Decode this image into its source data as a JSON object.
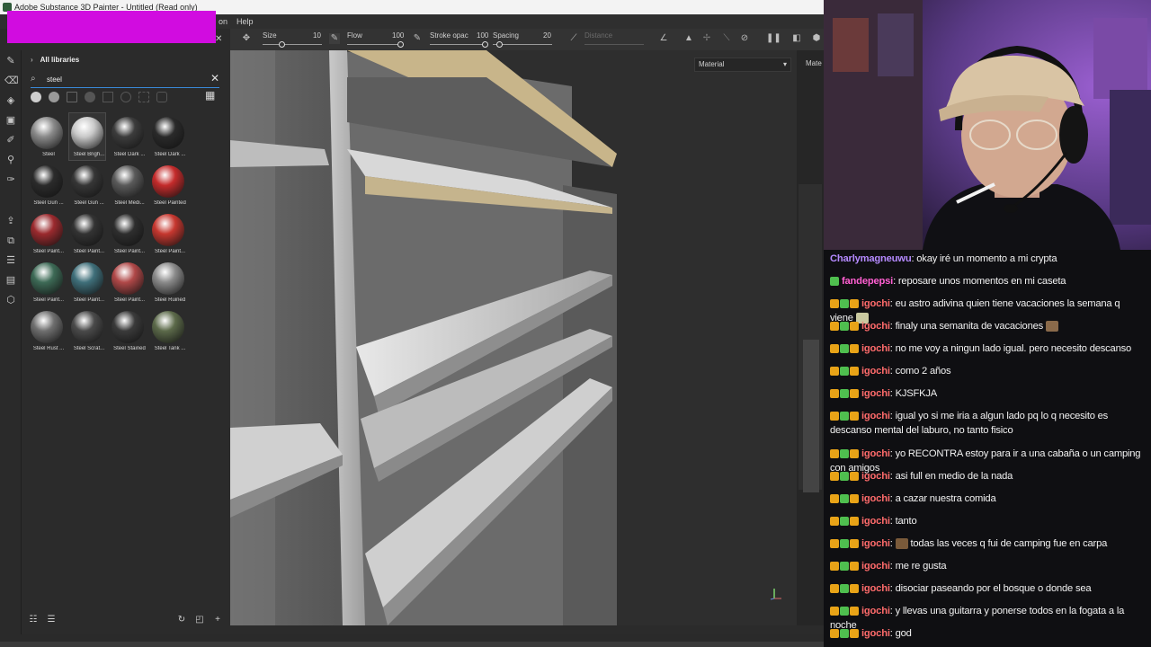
{
  "window": {
    "title": "Adobe Substance 3D Painter - Untitled (Read only)",
    "menu": [
      "on",
      "Help"
    ]
  },
  "toolbar": {
    "size_label": "Size",
    "size_value": "10",
    "flow_label": "Flow",
    "flow_value": "100",
    "stroke_label": "Stroke opac",
    "stroke_value": "100",
    "spacing_label": "Spacing",
    "spacing_value": "20",
    "distance_label": "Distance"
  },
  "assets": {
    "header": "All libraries",
    "search_value": "steel",
    "items": [
      {
        "label": "Steel",
        "color": "#8a8a8a"
      },
      {
        "label": "Steel Brigh...",
        "color": "#c9c9c9"
      },
      {
        "label": "Steel Dark ...",
        "color": "#3c3c3c"
      },
      {
        "label": "Steel Dark ...",
        "color": "#2a2a2a"
      },
      {
        "label": "Steel Gun ...",
        "color": "#2b2b2b"
      },
      {
        "label": "Steel Gun ...",
        "color": "#363636"
      },
      {
        "label": "Steel Medi...",
        "color": "#5a5a5a"
      },
      {
        "label": "Steel Painted",
        "color": "#c42b2b"
      },
      {
        "label": "Steel Paint...",
        "color": "#9b2a2e"
      },
      {
        "label": "Steel Paint...",
        "color": "#333333"
      },
      {
        "label": "Steel Paint...",
        "color": "#2e2e2e"
      },
      {
        "label": "Steel Paint...",
        "color": "#c6372f"
      },
      {
        "label": "Steel Paint...",
        "color": "#3d6a56"
      },
      {
        "label": "Steel Paint...",
        "color": "#3f6f7a"
      },
      {
        "label": "Steel Paint...",
        "color": "#b04848"
      },
      {
        "label": "Steel Ruined",
        "color": "#8a8a8a"
      },
      {
        "label": "Steel Rust ...",
        "color": "#6f6f6f"
      },
      {
        "label": "Steel Scrat...",
        "color": "#4a4a4a"
      },
      {
        "label": "Steel Stained",
        "color": "#3a3a3a"
      },
      {
        "label": "Steel Tank ...",
        "color": "#5c6a4a"
      }
    ]
  },
  "viewport": {
    "material_mode": "Material",
    "right_tab": "Mate"
  },
  "chat": [
    {
      "user": "Charlymagneuwu",
      "color": "#b58aff",
      "badges": 0,
      "text": "okay iré un momento a mi crypta"
    },
    {
      "user": "fandepepsi",
      "color": "#ff5fd2",
      "badges": 1,
      "text": "reposare unos momentos en mi caseta"
    },
    {
      "user": "igochi",
      "color": "#ff6b6b",
      "badges": 3,
      "text": "eu astro adivina quien tiene vacaciones la semana q viene",
      "emote": true
    },
    {
      "user": "igochi",
      "color": "#ff6b6b",
      "badges": 3,
      "text": "finaly una semanita de vacaciones",
      "emote": true
    },
    {
      "user": "igochi",
      "color": "#ff6b6b",
      "badges": 3,
      "text": "no me voy a ningun lado igual. pero necesito descanso"
    },
    {
      "user": "igochi",
      "color": "#ff6b6b",
      "badges": 3,
      "text": "como 2 años"
    },
    {
      "user": "igochi",
      "color": "#ff6b6b",
      "badges": 3,
      "text": "KJSFKJA"
    },
    {
      "user": "igochi",
      "color": "#ff6b6b",
      "badges": 3,
      "text": "igual yo si me iria a algun lado pq lo q necesito es descanso mental del laburo, no tanto fisico"
    },
    {
      "user": "igochi",
      "color": "#ff6b6b",
      "badges": 3,
      "text": "yo RECONTRA estoy para ir a una cabaña o un camping con amigos"
    },
    {
      "user": "igochi",
      "color": "#ff6b6b",
      "badges": 3,
      "text": "asi full en medio de la nada"
    },
    {
      "user": "igochi",
      "color": "#ff6b6b",
      "badges": 3,
      "text": "a cazar nuestra comida"
    },
    {
      "user": "igochi",
      "color": "#ff6b6b",
      "badges": 3,
      "text": "tanto"
    },
    {
      "user": "igochi",
      "color": "#ff6b6b",
      "badges": 3,
      "text": "todas las veces q fui de camping fue en carpa",
      "emote_before": true
    },
    {
      "user": "igochi",
      "color": "#ff6b6b",
      "badges": 3,
      "text": "me re gusta"
    },
    {
      "user": "igochi",
      "color": "#ff6b6b",
      "badges": 3,
      "text": "disociar paseando por el bosque o donde sea"
    },
    {
      "user": "igochi",
      "color": "#ff6b6b",
      "badges": 3,
      "text": "y llevas una guitarra y ponerse todos en la fogata a la noche"
    },
    {
      "user": "igochi",
      "color": "#ff6b6b",
      "badges": 3,
      "text": "god"
    }
  ],
  "colors": {
    "accent": "#3a8ad9",
    "overlay": "#d10ce0",
    "badge_gold": "#e8a317",
    "badge_green": "#4fbf4f"
  }
}
